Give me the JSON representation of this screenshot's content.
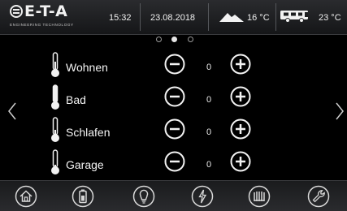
{
  "brand": {
    "logo_text": "E-T-A",
    "tagline": "ENGINEERING TECHNOLOGY"
  },
  "status": {
    "time": "15:32",
    "date": "23.08.2018",
    "outdoor_temp": "16 °C",
    "vehicle_temp": "23 °C"
  },
  "pager": {
    "pages": 3,
    "active_index": 1
  },
  "rooms": [
    {
      "label": "Wohnen",
      "value": "0"
    },
    {
      "label": "Bad",
      "value": "0"
    },
    {
      "label": "Schlafen",
      "value": "0"
    },
    {
      "label": "Garage",
      "value": "0"
    }
  ],
  "nav_icons": [
    "home-icon",
    "battery-icon",
    "lightbulb-icon",
    "power-icon",
    "heater-icon",
    "wrench-icon"
  ],
  "colors": {
    "background": "#000000",
    "foreground": "#ffffff",
    "bar": "#222326"
  }
}
